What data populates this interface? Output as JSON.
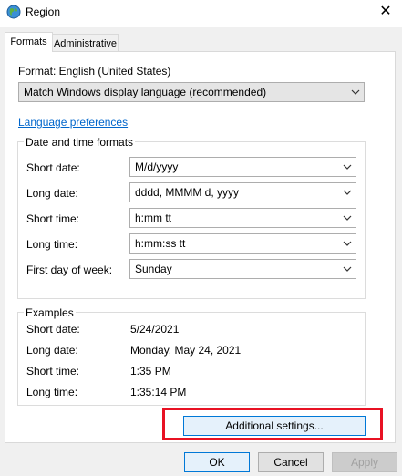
{
  "window": {
    "title": "Region",
    "close_symbol": "✕"
  },
  "tabs": [
    {
      "label": "Formats",
      "active": true
    },
    {
      "label": "Administrative",
      "active": false
    }
  ],
  "format": {
    "label": "Format: English (United States)",
    "selected": "Match Windows display language (recommended)"
  },
  "language_link": "Language preferences",
  "date_time_formats": {
    "title": "Date and time formats",
    "rows": [
      {
        "label": "Short date:",
        "value": "M/d/yyyy"
      },
      {
        "label": "Long date:",
        "value": "dddd, MMMM d, yyyy"
      },
      {
        "label": "Short time:",
        "value": "h:mm tt"
      },
      {
        "label": "Long time:",
        "value": "h:mm:ss tt"
      },
      {
        "label": "First day of week:",
        "value": "Sunday"
      }
    ]
  },
  "examples": {
    "title": "Examples",
    "rows": [
      {
        "label": "Short date:",
        "value": "5/24/2021"
      },
      {
        "label": "Long date:",
        "value": "Monday, May 24, 2021"
      },
      {
        "label": "Short time:",
        "value": "1:35 PM"
      },
      {
        "label": "Long time:",
        "value": "1:35:14 PM"
      }
    ]
  },
  "buttons": {
    "additional": "Additional settings...",
    "ok": "OK",
    "cancel": "Cancel",
    "apply": "Apply"
  },
  "colors": {
    "highlight": "#e81123",
    "link": "#0066cc",
    "focus": "#0078d7"
  },
  "icons": {
    "window": "globe-icon",
    "dropdown": "chevron-down-icon",
    "close": "close-icon"
  }
}
